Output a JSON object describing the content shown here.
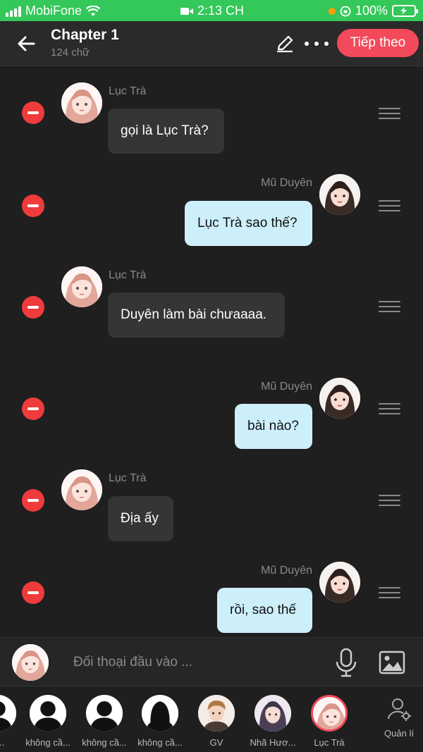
{
  "status_bar": {
    "carrier": "MobiFone",
    "time": "2:13 CH",
    "battery": "100%"
  },
  "header": {
    "title": "Chapter 1",
    "subtitle": "124 chữ",
    "next_label": "Tiếp theo"
  },
  "messages": [
    {
      "sender": "Lục Trà",
      "text": "gọi là Lục Trà?",
      "side": "left"
    },
    {
      "sender": "Mũ Duyên",
      "text": "Lục Trà sao thế?",
      "side": "right"
    },
    {
      "sender": "Lục Trà",
      "text": "Duyên làm bài chưaaaa.",
      "side": "left"
    },
    {
      "sender": "Mũ Duyên",
      "text": "bài nào?",
      "side": "right"
    },
    {
      "sender": "Lục Trà",
      "text": "Địa ấy",
      "side": "left"
    },
    {
      "sender": "Mũ Duyên",
      "text": "rồi, sao thế",
      "side": "right"
    }
  ],
  "input": {
    "placeholder": "Đối thoại đầu vào ..."
  },
  "characters": [
    {
      "label": "n..."
    },
    {
      "label": "không cầ..."
    },
    {
      "label": "không cầ..."
    },
    {
      "label": "không cầ..."
    },
    {
      "label": "GV"
    },
    {
      "label": "Nhã Hươ..."
    },
    {
      "label": "Lục Trà"
    }
  ],
  "manage_label": "Quản lí",
  "colors": {
    "accent": "#f24a5a",
    "status_green": "#34c759",
    "bubble_right": "#cdeffa",
    "remove_red": "#ef3b3b"
  }
}
